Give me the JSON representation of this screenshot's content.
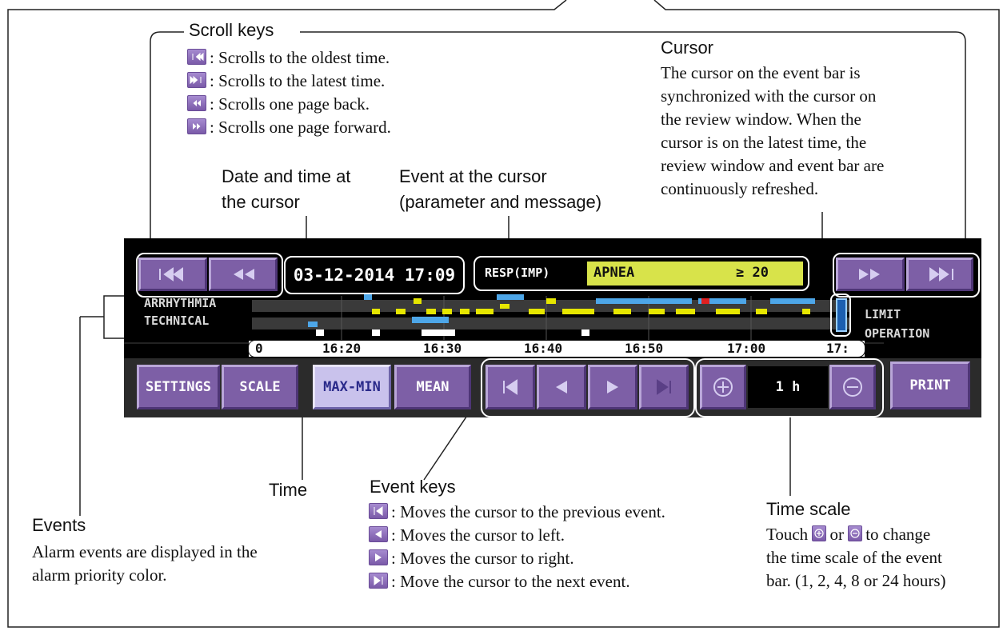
{
  "scroll_keys": {
    "title": "Scroll keys",
    "items": [
      {
        "icon": "skip-first-icon",
        "text": ": Scrolls to the oldest time."
      },
      {
        "icon": "skip-last-icon",
        "text": ": Scrolls to the latest time."
      },
      {
        "icon": "page-back-icon",
        "text": ": Scrolls one page back."
      },
      {
        "icon": "page-forward-icon",
        "text": ": Scrolls one page forward."
      }
    ]
  },
  "cursor_callout": {
    "title": "Cursor",
    "lines": [
      "The cursor on the event bar is",
      "synchronized with the cursor on",
      "the review window. When the",
      "cursor is on the latest time, the",
      "review window and event bar are",
      "continuously refreshed."
    ]
  },
  "datetime_callout": {
    "lines": [
      "Date and time at",
      "the cursor"
    ]
  },
  "event_cursor_callout": {
    "lines": [
      "Event at the cursor",
      "(parameter and message)"
    ]
  },
  "time_callout": {
    "title": "Time"
  },
  "events_callout": {
    "title": "Events",
    "lines": [
      "Alarm events are displayed in the",
      "alarm priority color."
    ]
  },
  "event_keys": {
    "title": "Event keys",
    "items": [
      {
        "icon": "prev-event-icon",
        "text": ": Moves the cursor to the previous event."
      },
      {
        "icon": "cursor-left-icon",
        "text": ": Moves the cursor to left."
      },
      {
        "icon": "cursor-right-icon",
        "text": ": Moves the cursor to right."
      },
      {
        "icon": "next-event-icon",
        "text": ": Move the cursor to the next event."
      }
    ]
  },
  "time_scale": {
    "title": "Time scale",
    "lines": [
      "to change",
      "the time scale of the event",
      "bar. (1, 2, 4, 8 or 24 hours)"
    ],
    "touch": "Touch",
    "or": "or"
  },
  "device": {
    "datetime": "03-12-2014 17:09",
    "param": "RESP(IMP)",
    "message": "APNEA",
    "threshold": "≥ 20",
    "rows": [
      "ARRHYTHMIA",
      "TECHNICAL"
    ],
    "right_labels": [
      "LIMIT",
      "OPERATION"
    ],
    "time_ticks": [
      "0",
      "16:20",
      "16:30",
      "16:40",
      "16:50",
      "17:00",
      "17:"
    ],
    "buttons": {
      "settings": "SETTINGS",
      "scale": "SCALE",
      "maxmin": "MAX-MIN",
      "mean": "MEAN",
      "scale_value": "1 h",
      "print": "PRINT"
    }
  },
  "colors": {
    "button": "#7d5fa6",
    "event_yellow": "#e6e600",
    "event_blue": "#4da6e8",
    "event_red": "#e02020",
    "message_bar": "#d8e34a"
  }
}
